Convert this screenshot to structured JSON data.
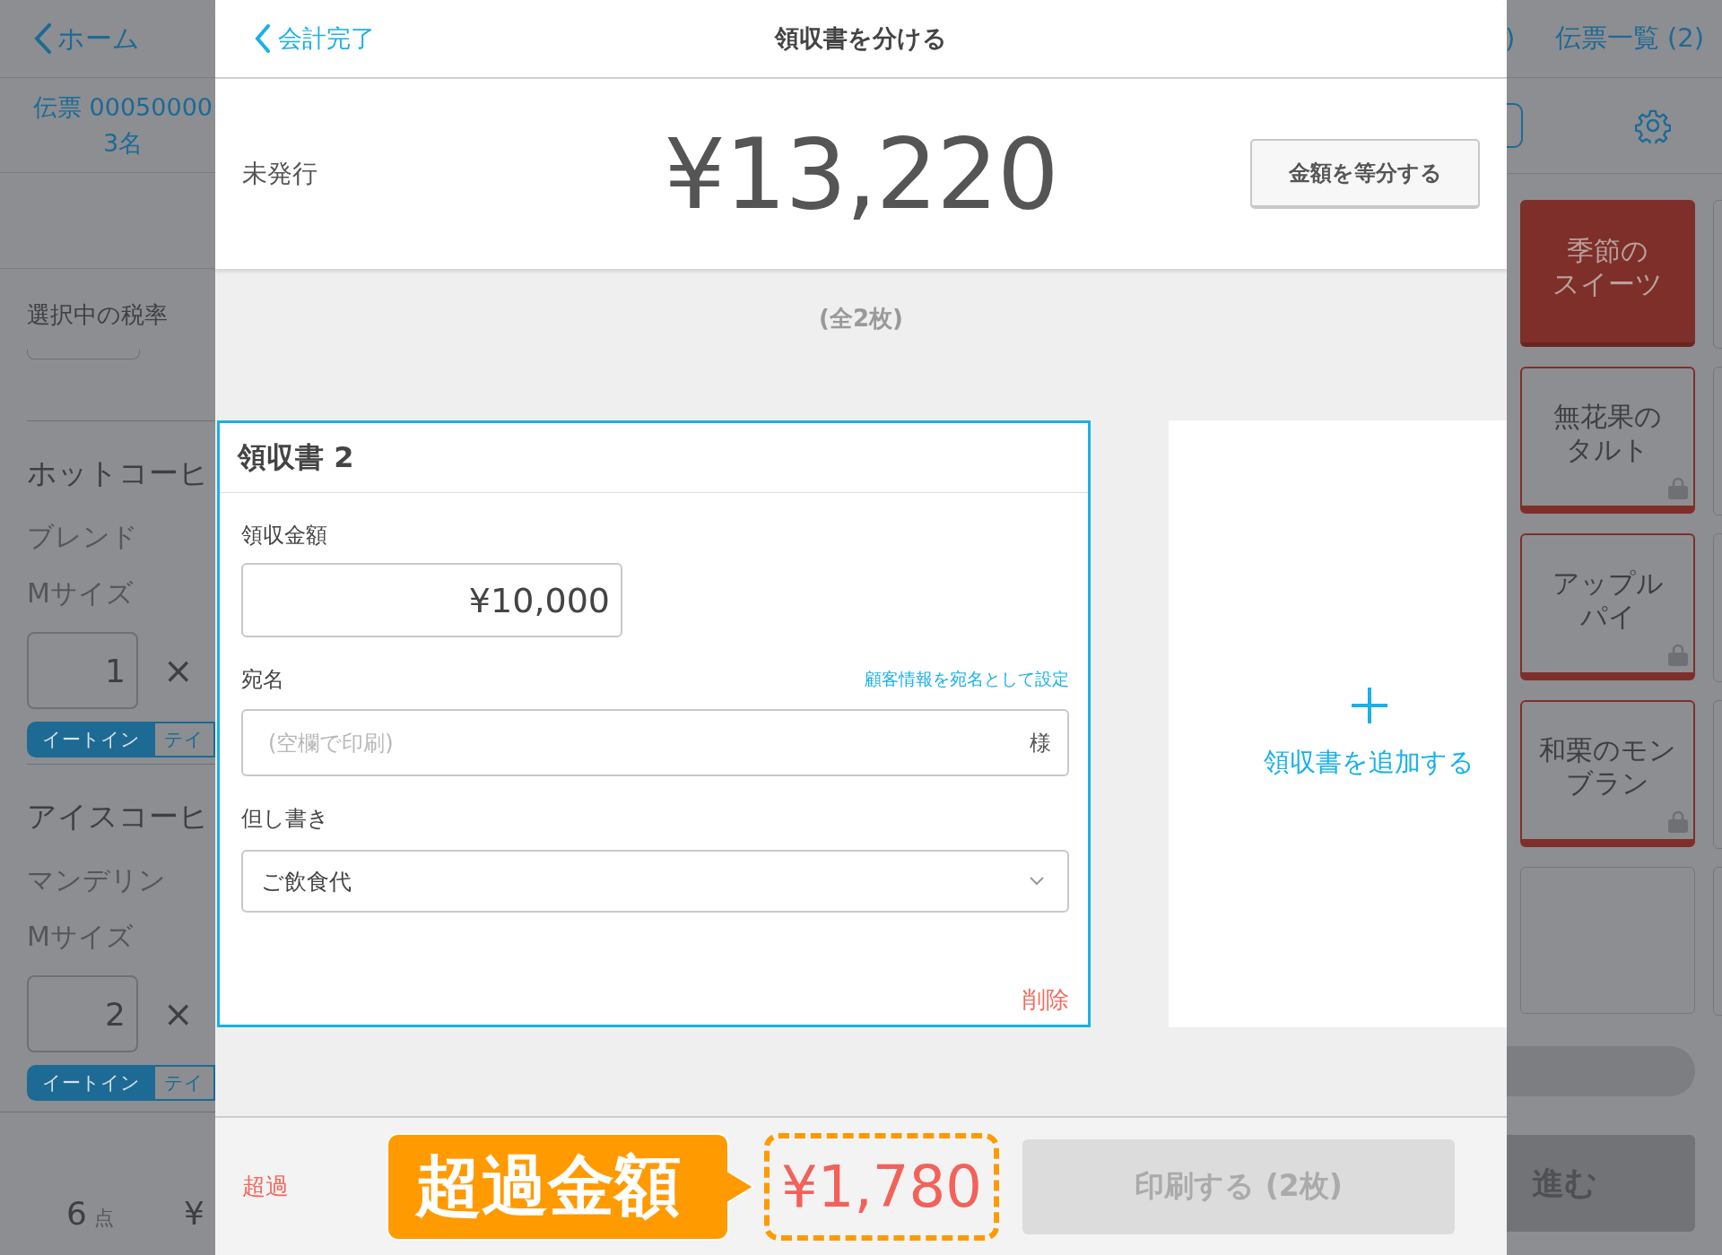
{
  "background_app": {
    "header": {
      "back_label": "ホーム",
      "cut_text": ")",
      "ticket_list": "伝票一覧 (2)"
    },
    "ticket": {
      "number": "伝票 00050000",
      "guests": "3名"
    },
    "tax_rate_label": "選択中の税率",
    "order_items": [
      {
        "name": "ホットコーヒ",
        "variant": "ブレンド",
        "size": "Mサイズ",
        "quantity": "1",
        "times": "×",
        "dine_options": [
          {
            "label": "イートイン",
            "selected": true
          },
          {
            "label": "テイ",
            "selected": false
          }
        ]
      },
      {
        "name": "アイスコーヒ",
        "variant": "マンデリン",
        "size": "Mサイズ",
        "quantity": "2",
        "times": "×",
        "dine_options": [
          {
            "label": "イートイン",
            "selected": true
          },
          {
            "label": "テイ",
            "selected": false
          }
        ]
      }
    ],
    "footer": {
      "count": "6",
      "unit": "点",
      "price": "¥"
    },
    "menu_tiles": [
      {
        "kind": "category",
        "lines": [
          "季節の",
          "スイーツ"
        ]
      },
      {
        "kind": "product",
        "lines": [
          "無花果の",
          "タルト"
        ]
      },
      {
        "kind": "product",
        "lines": [
          "アップル",
          "パイ"
        ]
      },
      {
        "kind": "product",
        "lines": [
          "和栗のモン",
          "ブラン"
        ]
      },
      {
        "kind": "empty"
      }
    ],
    "next_button": "進む"
  },
  "dialog": {
    "back_label": "会計完了",
    "title": "領収書を分ける",
    "status": "未発行",
    "total": "¥13,220",
    "split_button": "金額を等分する",
    "count_label": "(全2枚)",
    "receipt": {
      "title": "領収書 2",
      "selected": true,
      "amount_label": "領収金額",
      "amount": "¥10,000",
      "addressee_label": "宛名",
      "addressee_link": "顧客情報を宛名として設定",
      "addressee_placeholder": "(空欄で印刷)",
      "addressee_suffix": "様",
      "note_label": "但し書き",
      "note_value": "ご飲食代",
      "delete_label": "削除"
    },
    "add_receipt": "領収書を追加する",
    "footer": {
      "status": "超過",
      "callout": "超過金額",
      "over_amount": "¥1,780",
      "print_button": "印刷する (2枚)",
      "print_disabled": true
    }
  }
}
